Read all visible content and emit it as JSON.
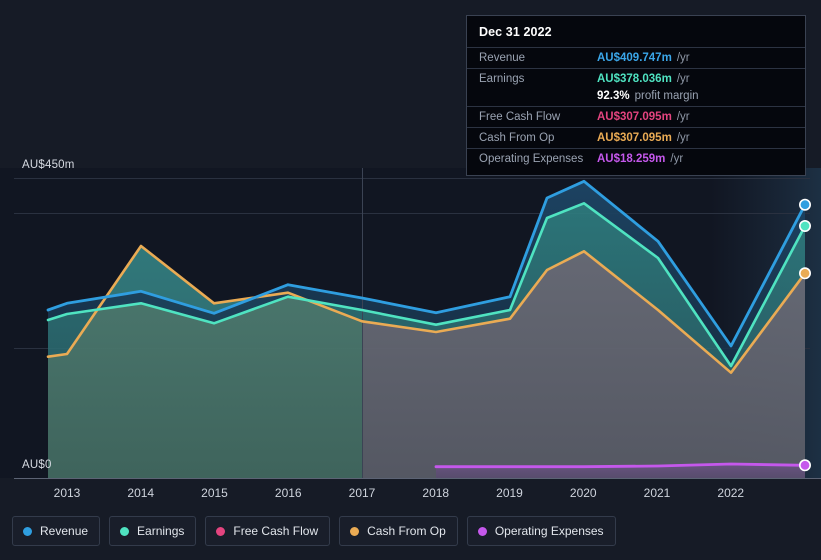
{
  "axes": {
    "y_top_label": "AU$450m",
    "y_zero_label": "AU$0",
    "x_ticks": [
      "2013",
      "2014",
      "2015",
      "2016",
      "2017",
      "2018",
      "2019",
      "2020",
      "2021",
      "2022"
    ]
  },
  "tooltip": {
    "date": "Dec 31 2022",
    "rows": [
      {
        "key": "Revenue",
        "value": "AU$409.747m",
        "unit": "/yr",
        "color": "#3ba7ea"
      },
      {
        "key": "Earnings",
        "value": "AU$378.036m",
        "unit": "/yr",
        "color": "#4fe3c1"
      },
      {
        "key": "Free Cash Flow",
        "value": "AU$307.095m",
        "unit": "/yr",
        "color": "#e4447f"
      },
      {
        "key": "Cash From Op",
        "value": "AU$307.095m",
        "unit": "/yr",
        "color": "#eaab54"
      },
      {
        "key": "Operating Expenses",
        "value": "AU$18.259m",
        "unit": "/yr",
        "color": "#c558ec"
      }
    ],
    "margin_value": "92.3%",
    "margin_text": "profit margin"
  },
  "legend": [
    {
      "label": "Revenue",
      "color": "#2f9ee0"
    },
    {
      "label": "Earnings",
      "color": "#4fe3c1"
    },
    {
      "label": "Free Cash Flow",
      "color": "#e4447f"
    },
    {
      "label": "Cash From Op",
      "color": "#eaab54"
    },
    {
      "label": "Operating Expenses",
      "color": "#c558ec"
    }
  ],
  "chart_data": {
    "type": "area",
    "title": "",
    "xlabel": "",
    "ylabel": "AU$",
    "ylim": [
      0,
      450
    ],
    "y_ticks": [
      0,
      450
    ],
    "grid": true,
    "legend_position": "bottom",
    "currency": "AU$",
    "units": "millions per year",
    "x": [
      2012.7,
      2013,
      2014,
      2015,
      2016,
      2017,
      2018,
      2019,
      2019.5,
      2020,
      2021,
      2022,
      2022.75
    ],
    "forecast_boundary": 2017,
    "series": [
      {
        "name": "Revenue",
        "color": "#2f9ee0",
        "values": [
          252,
          262,
          280,
          248,
          290,
          270,
          248,
          272,
          420,
          445,
          355,
          198,
          410
        ]
      },
      {
        "name": "Earnings",
        "color": "#4fe3c1",
        "values": [
          237,
          246,
          262,
          232,
          272,
          252,
          230,
          252,
          390,
          412,
          330,
          168,
          378
        ]
      },
      {
        "name": "Free Cash Flow",
        "color": "#e4447f",
        "values": [
          null,
          null,
          null,
          null,
          null,
          null,
          null,
          null,
          null,
          null,
          null,
          null,
          307
        ]
      },
      {
        "name": "Cash From Op",
        "color": "#eaab54",
        "values": [
          182,
          186,
          348,
          262,
          278,
          235,
          218,
          238,
          312,
          340,
          252,
          158,
          307
        ]
      },
      {
        "name": "Operating Expenses",
        "color": "#c558ec",
        "values": [
          null,
          null,
          null,
          null,
          null,
          null,
          17,
          17,
          17,
          17,
          17,
          19,
          18.259
        ]
      }
    ]
  }
}
